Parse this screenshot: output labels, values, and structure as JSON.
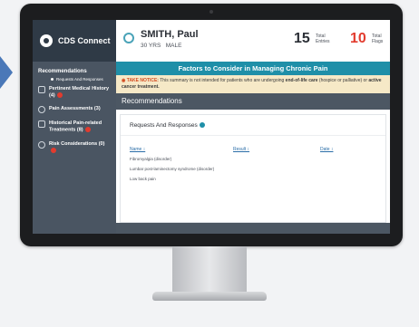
{
  "app": {
    "name": "CDS Connect",
    "logo_icon": "cds-logo-icon"
  },
  "sidebar": {
    "heading": "Recommendations",
    "sub_item": "Requests And Responses",
    "items": [
      {
        "label": "Pertinent Medical History (4)",
        "icon": "history-icon",
        "flag": true
      },
      {
        "label": "Pain Assessments (3)",
        "icon": "assessment-icon",
        "flag": false
      },
      {
        "label": "Historical Pain-related Treatments (8)",
        "icon": "treatment-icon",
        "flag": true
      },
      {
        "label": "Risk Considerations (0)",
        "icon": "risk-icon",
        "flag": true
      }
    ]
  },
  "patient": {
    "name": "SMITH, Paul",
    "age": "30 YRS",
    "sex": "MALE"
  },
  "stats": {
    "entries": {
      "value": "15",
      "label_1": "Total",
      "label_2": "Entries",
      "color": "#2b2f36"
    },
    "flags": {
      "value": "10",
      "label_1": "Total",
      "label_2": "Flags",
      "color": "#e23b2e"
    }
  },
  "banner": {
    "title": "Factors to Consider in Managing Chronic Pain"
  },
  "notice": {
    "prefix": "TAKE NOTICE:",
    "text_1": " This summary is not intended for patients who are undergoing ",
    "bold_1": "end-of-life care",
    "text_2": " (hospice or palliative) or ",
    "bold_2": "active cancer treatment.",
    "line_2": "cancer treatment."
  },
  "recommendations": {
    "title": "Recommendations",
    "card_title": "Requests And Responses",
    "columns": [
      "Name ↕",
      "Result ↕",
      "Date ↕"
    ],
    "rows": [
      "Fibromyalgia (disorder)",
      "Lumbar post-laminectomy syndrome (disorder)",
      "Low back pain"
    ]
  },
  "colors": {
    "accent": "#1f8fa8",
    "flag": "#e23b2e",
    "sidebar": "#4a5562",
    "notice_bg": "#f6e9c7"
  }
}
